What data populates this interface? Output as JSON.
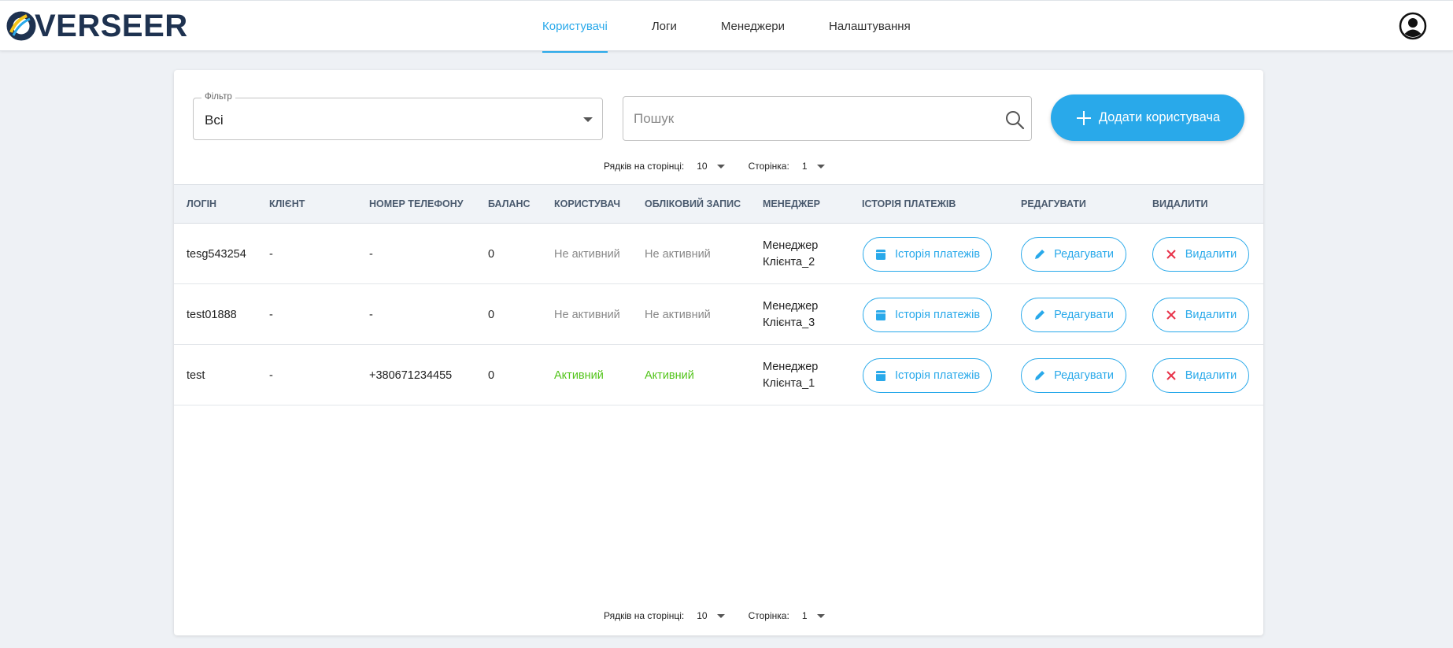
{
  "header": {
    "logo_text": "VERSEER",
    "nav": [
      {
        "label": "Користувачі",
        "active": true
      },
      {
        "label": "Логи",
        "active": false
      },
      {
        "label": "Менеджери",
        "active": false
      },
      {
        "label": "Налаштування",
        "active": false
      }
    ]
  },
  "toolbar": {
    "filter_label": "Фільтр",
    "filter_value": "Всі",
    "search_placeholder": "Пошук",
    "search_value": "",
    "add_button_label": "Додати користувача"
  },
  "pagination": {
    "rows_label": "Рядків на сторінці:",
    "rows_value": "10",
    "page_label": "Сторінка:",
    "page_value": "1"
  },
  "table": {
    "columns": [
      "Логін",
      "Клієнт",
      "Номер телефону",
      "Баланс",
      "Користувач",
      "Обліковий запис",
      "Менеджер",
      "Історія платежів",
      "Редагувати",
      "Видалити"
    ],
    "action_labels": {
      "history": "Історія платежів",
      "edit": "Редагувати",
      "delete": "Видалити"
    },
    "rows": [
      {
        "login": "tesg543254",
        "client": "-",
        "phone": "-",
        "balance": "0",
        "user_status": "Не активний",
        "account_status": "Не активний",
        "manager_line1": "Менеджер",
        "manager_line2": "Клієнта_2"
      },
      {
        "login": "test01888",
        "client": "-",
        "phone": "-",
        "balance": "0",
        "user_status": "Не активний",
        "account_status": "Не активний",
        "manager_line1": "Менеджер",
        "manager_line2": "Клієнта_3"
      },
      {
        "login": "test",
        "client": "-",
        "phone": "+380671234455",
        "balance": "0",
        "user_status": "Активний",
        "account_status": "Активний",
        "manager_line1": "Менеджер",
        "manager_line2": "Клієнта_1"
      }
    ]
  },
  "colors": {
    "accent": "#29a9ea",
    "active_status": "#52c41a",
    "inactive_status": "#888888",
    "delete_icon": "#e8334a",
    "logo_dark": "#1e3250",
    "logo_yellow": "#f5c518"
  },
  "icons": [
    "logo-o-icon",
    "account-circle-icon",
    "dropdown-arrow-icon",
    "search-icon",
    "plus-icon",
    "calendar-icon",
    "pencil-icon",
    "close-x-icon"
  ]
}
